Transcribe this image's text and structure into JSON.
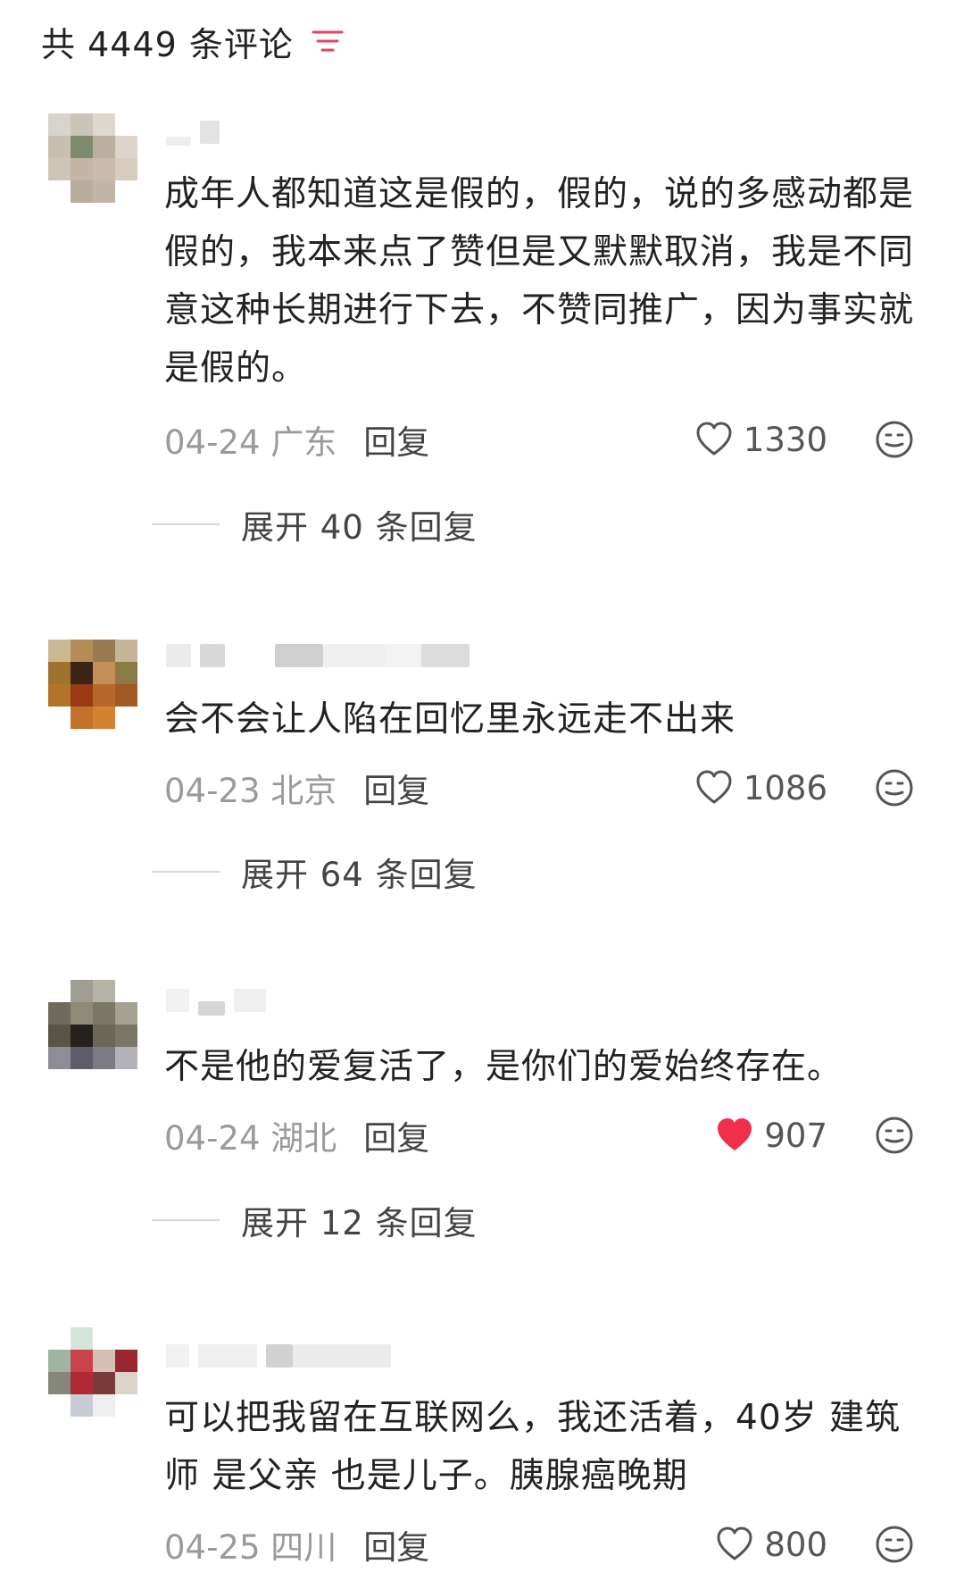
{
  "header": {
    "title": "共 4449 条评论",
    "sort_icon": "sort-lines-icon",
    "accent": "#e8455a"
  },
  "comments": [
    {
      "text": "成年人都知道这是假的，假的，说的多感动都是假的，我本来点了赞但是又默默取消，我是不同意这种长期进行下去，不赞同推广，因为事实就是假的。",
      "date": "04-24 广东",
      "reply": "回复",
      "likes": "1330",
      "liked": false,
      "expand": "展开 40 条回复"
    },
    {
      "text": "会不会让人陷在回忆里永远走不出来",
      "date": "04-23 北京",
      "reply": "回复",
      "likes": "1086",
      "liked": false,
      "expand": "展开 64 条回复"
    },
    {
      "text": "不是他的爱复活了，是你们的爱始终存在。",
      "date": "04-24 湖北",
      "reply": "回复",
      "likes": "907",
      "liked": true,
      "expand": "展开 12 条回复"
    },
    {
      "text": "可以把我留在互联网么，我还活着，40岁 建筑师 是父亲 也是儿子。胰腺癌晚期",
      "date": "04-25 四川",
      "reply": "回复",
      "likes": "800",
      "liked": false
    }
  ],
  "colors": {
    "liked_heart": "#f0304a",
    "muted_text": "#9a9a9a",
    "body_text": "#222222"
  }
}
